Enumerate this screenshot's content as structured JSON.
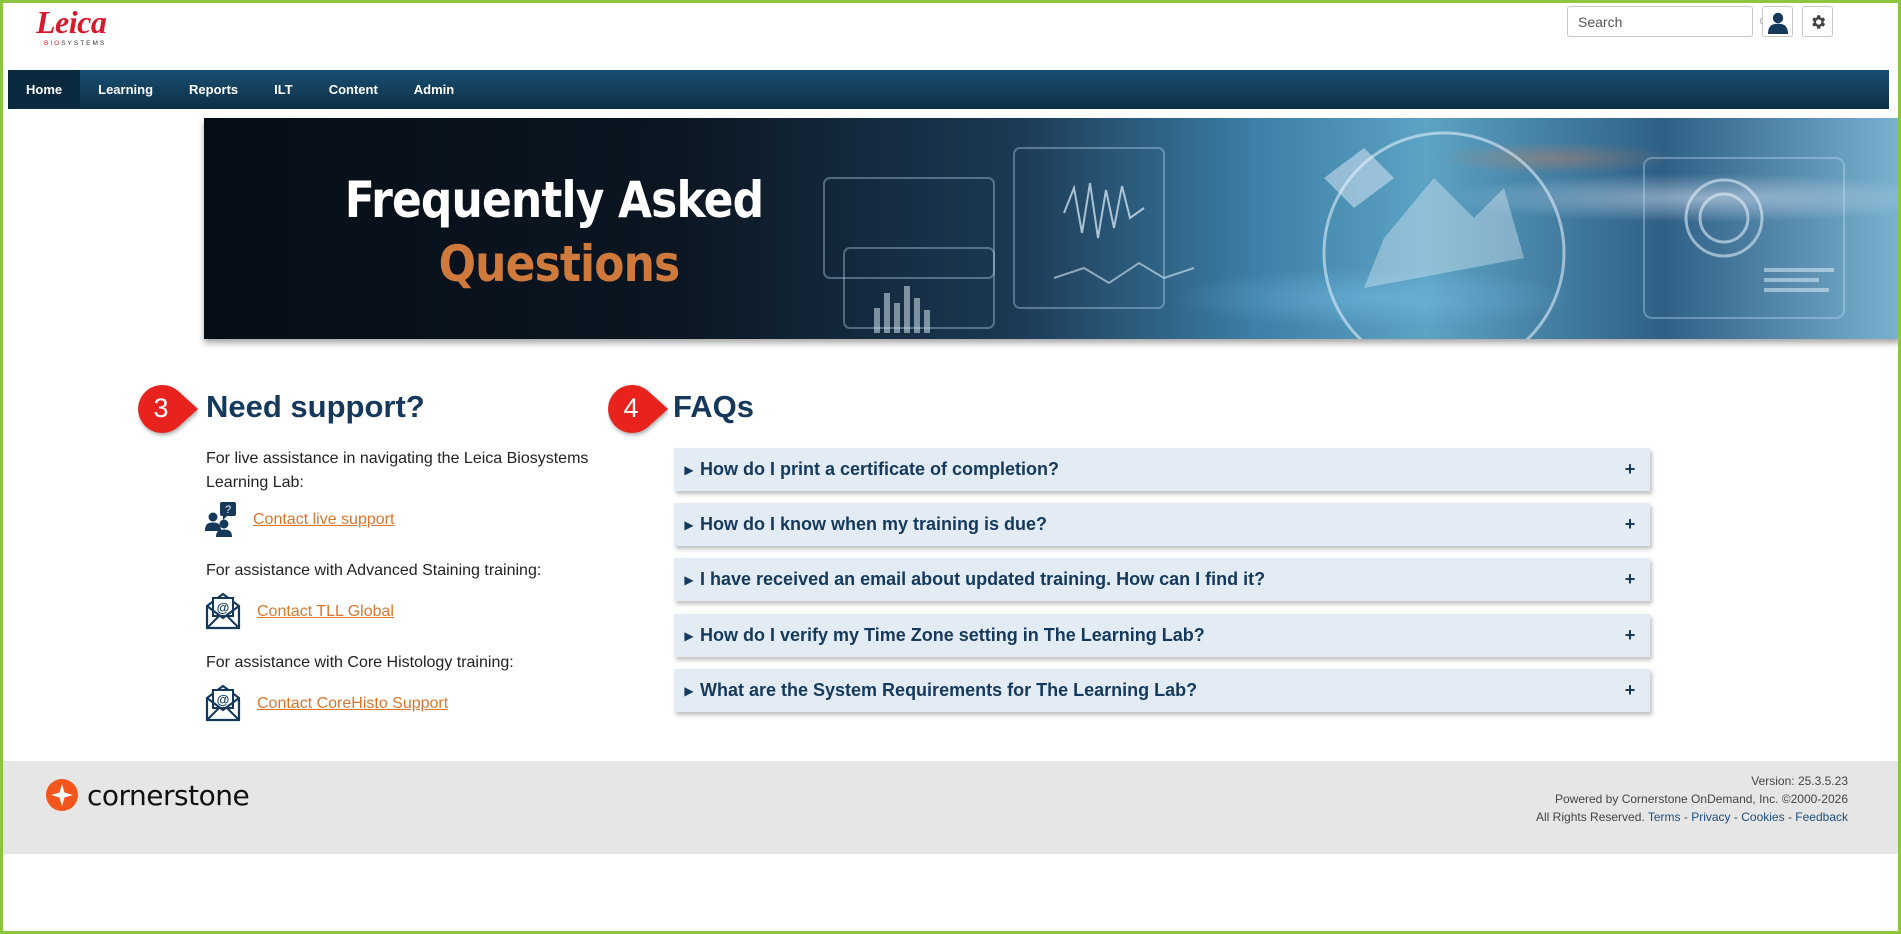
{
  "header": {
    "logo_text": "Leica",
    "logo_sub_bio": "BIO",
    "logo_sub_rest": "SYSTEMS",
    "search_placeholder": "Search"
  },
  "nav": {
    "items": [
      {
        "label": "Home",
        "active": true
      },
      {
        "label": "Learning"
      },
      {
        "label": "Reports"
      },
      {
        "label": "ILT"
      },
      {
        "label": "Content"
      },
      {
        "label": "Admin"
      }
    ]
  },
  "banner": {
    "line1": "Frequently Asked",
    "line2": "Questions"
  },
  "markers": {
    "support_number": "3",
    "faq_number": "4",
    "color": "#e8231e"
  },
  "support": {
    "title": "Need support?",
    "live_text": "For live assistance in navigating the Leica Biosystems Learning Lab:",
    "live_link": "Contact live support",
    "staining_text": "For assistance with Advanced Staining training:",
    "staining_link": "Contact TLL Global",
    "histo_text": "For assistance with Core Histology training:",
    "histo_link": "Contact CoreHisto Support"
  },
  "faqs": {
    "title": "FAQs",
    "items": [
      {
        "question": "How do I print a certificate of completion?"
      },
      {
        "question": "How do I know when my training is due?"
      },
      {
        "question": "I have received an email about updated training. How can I find it?"
      },
      {
        "question": "How do I verify my Time Zone setting in The Learning Lab?"
      },
      {
        "question": "What are the System Requirements for The Learning Lab?"
      }
    ],
    "expand_symbol": "+",
    "arrow_symbol": "▶"
  },
  "footer": {
    "brand": "cornerstone",
    "version": "Version: 25.3.5.23",
    "powered": "Powered by Cornerstone OnDemand, Inc. ©2000-2026",
    "rights": "All Rights Reserved.",
    "terms": "Terms",
    "privacy": "Privacy",
    "cookies": "Cookies",
    "feedback": "Feedback",
    "separator": "-"
  },
  "colors": {
    "nav_bg": "#0b2f47",
    "heading": "#14395b",
    "link": "#d9762e",
    "faq_bg": "#e3ebf5",
    "frame": "#8cc63f"
  }
}
